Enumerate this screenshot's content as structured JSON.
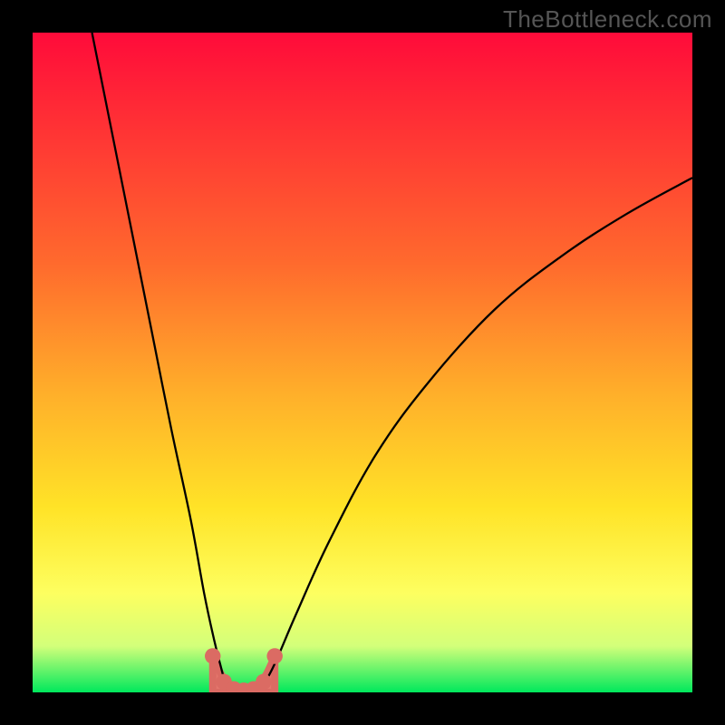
{
  "watermark": "TheBottleneck.com",
  "chart_data": {
    "type": "line",
    "title": "",
    "xlabel": "",
    "ylabel": "",
    "xlim": [
      0,
      100
    ],
    "ylim": [
      0,
      100
    ],
    "gradient_stops": [
      {
        "offset": 0,
        "color": "#ff0b3a"
      },
      {
        "offset": 35,
        "color": "#ff6a2d"
      },
      {
        "offset": 55,
        "color": "#ffb02a"
      },
      {
        "offset": 72,
        "color": "#ffe327"
      },
      {
        "offset": 85,
        "color": "#fdff60"
      },
      {
        "offset": 93,
        "color": "#d3ff7a"
      },
      {
        "offset": 100,
        "color": "#00e85c"
      }
    ],
    "series": [
      {
        "name": "left-branch",
        "x": [
          9,
          12,
          15,
          18,
          21,
          24,
          26,
          27.5,
          28.5,
          29.2,
          29.8
        ],
        "y": [
          100,
          85,
          70,
          55,
          40,
          26,
          15,
          8,
          4,
          1.5,
          0.5
        ]
      },
      {
        "name": "right-branch",
        "x": [
          34.5,
          35.5,
          37,
          40,
          45,
          52,
          60,
          70,
          80,
          90,
          100
        ],
        "y": [
          0.5,
          2,
          5,
          12,
          23,
          36,
          47,
          58,
          66,
          72.5,
          78
        ]
      },
      {
        "name": "valley-fill",
        "color": "#e4766c",
        "x": [
          27.3,
          28.6,
          29.7,
          30.7,
          31.6,
          32.4,
          33.3,
          34.3,
          35.4,
          36.7
        ],
        "y": [
          5.5,
          2.7,
          1.2,
          0.5,
          0.3,
          0.3,
          0.5,
          1.2,
          2.7,
          5.5
        ]
      }
    ],
    "valley_markers": {
      "color": "#db6b63",
      "radius": 1.2,
      "points": [
        {
          "x": 27.3,
          "y": 5.5
        },
        {
          "x": 29.0,
          "y": 1.6
        },
        {
          "x": 30.5,
          "y": 0.5
        },
        {
          "x": 32.0,
          "y": 0.3
        },
        {
          "x": 33.5,
          "y": 0.5
        },
        {
          "x": 35.0,
          "y": 1.6
        },
        {
          "x": 36.7,
          "y": 5.5
        }
      ]
    }
  }
}
